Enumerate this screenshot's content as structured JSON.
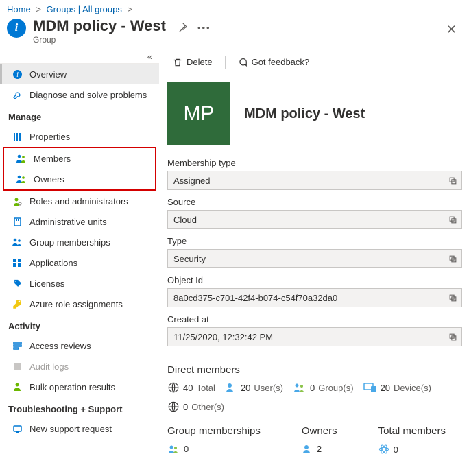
{
  "breadcrumb": {
    "home": "Home",
    "groups": "Groups | All groups"
  },
  "header": {
    "title": "MDM policy - West",
    "subtitle": "Group"
  },
  "sidebar": {
    "collapse_glyph": "«",
    "overview": "Overview",
    "diagnose": "Diagnose and solve problems",
    "section_manage": "Manage",
    "properties": "Properties",
    "members": "Members",
    "owners": "Owners",
    "roles": "Roles and administrators",
    "admin_units": "Administrative units",
    "group_memberships": "Group memberships",
    "applications": "Applications",
    "licenses": "Licenses",
    "azure_roles": "Azure role assignments",
    "section_activity": "Activity",
    "access_reviews": "Access reviews",
    "audit_logs": "Audit logs",
    "bulk_ops": "Bulk operation results",
    "section_ts": "Troubleshooting + Support",
    "support": "New support request"
  },
  "toolbar": {
    "delete": "Delete",
    "feedback": "Got feedback?"
  },
  "identity": {
    "initials": "MP",
    "title": "MDM policy - West"
  },
  "fields": {
    "membership_type_label": "Membership type",
    "membership_type": "Assigned",
    "source_label": "Source",
    "source": "Cloud",
    "type_label": "Type",
    "type": "Security",
    "object_id_label": "Object Id",
    "object_id": "8a0cd375-c701-42f4-b074-c54f70a32da0",
    "created_label": "Created at",
    "created": "11/25/2020, 12:32:42 PM"
  },
  "direct": {
    "heading": "Direct members",
    "total_n": "40",
    "total_l": "Total",
    "users_n": "20",
    "users_l": "User(s)",
    "groups_n": "0",
    "groups_l": "Group(s)",
    "devices_n": "20",
    "devices_l": "Device(s)",
    "others_n": "0",
    "others_l": "Other(s)"
  },
  "summary": {
    "gm_label": "Group memberships",
    "gm_value": "0",
    "owners_label": "Owners",
    "owners_value": "2",
    "tm_label": "Total members",
    "tm_value": "0"
  }
}
